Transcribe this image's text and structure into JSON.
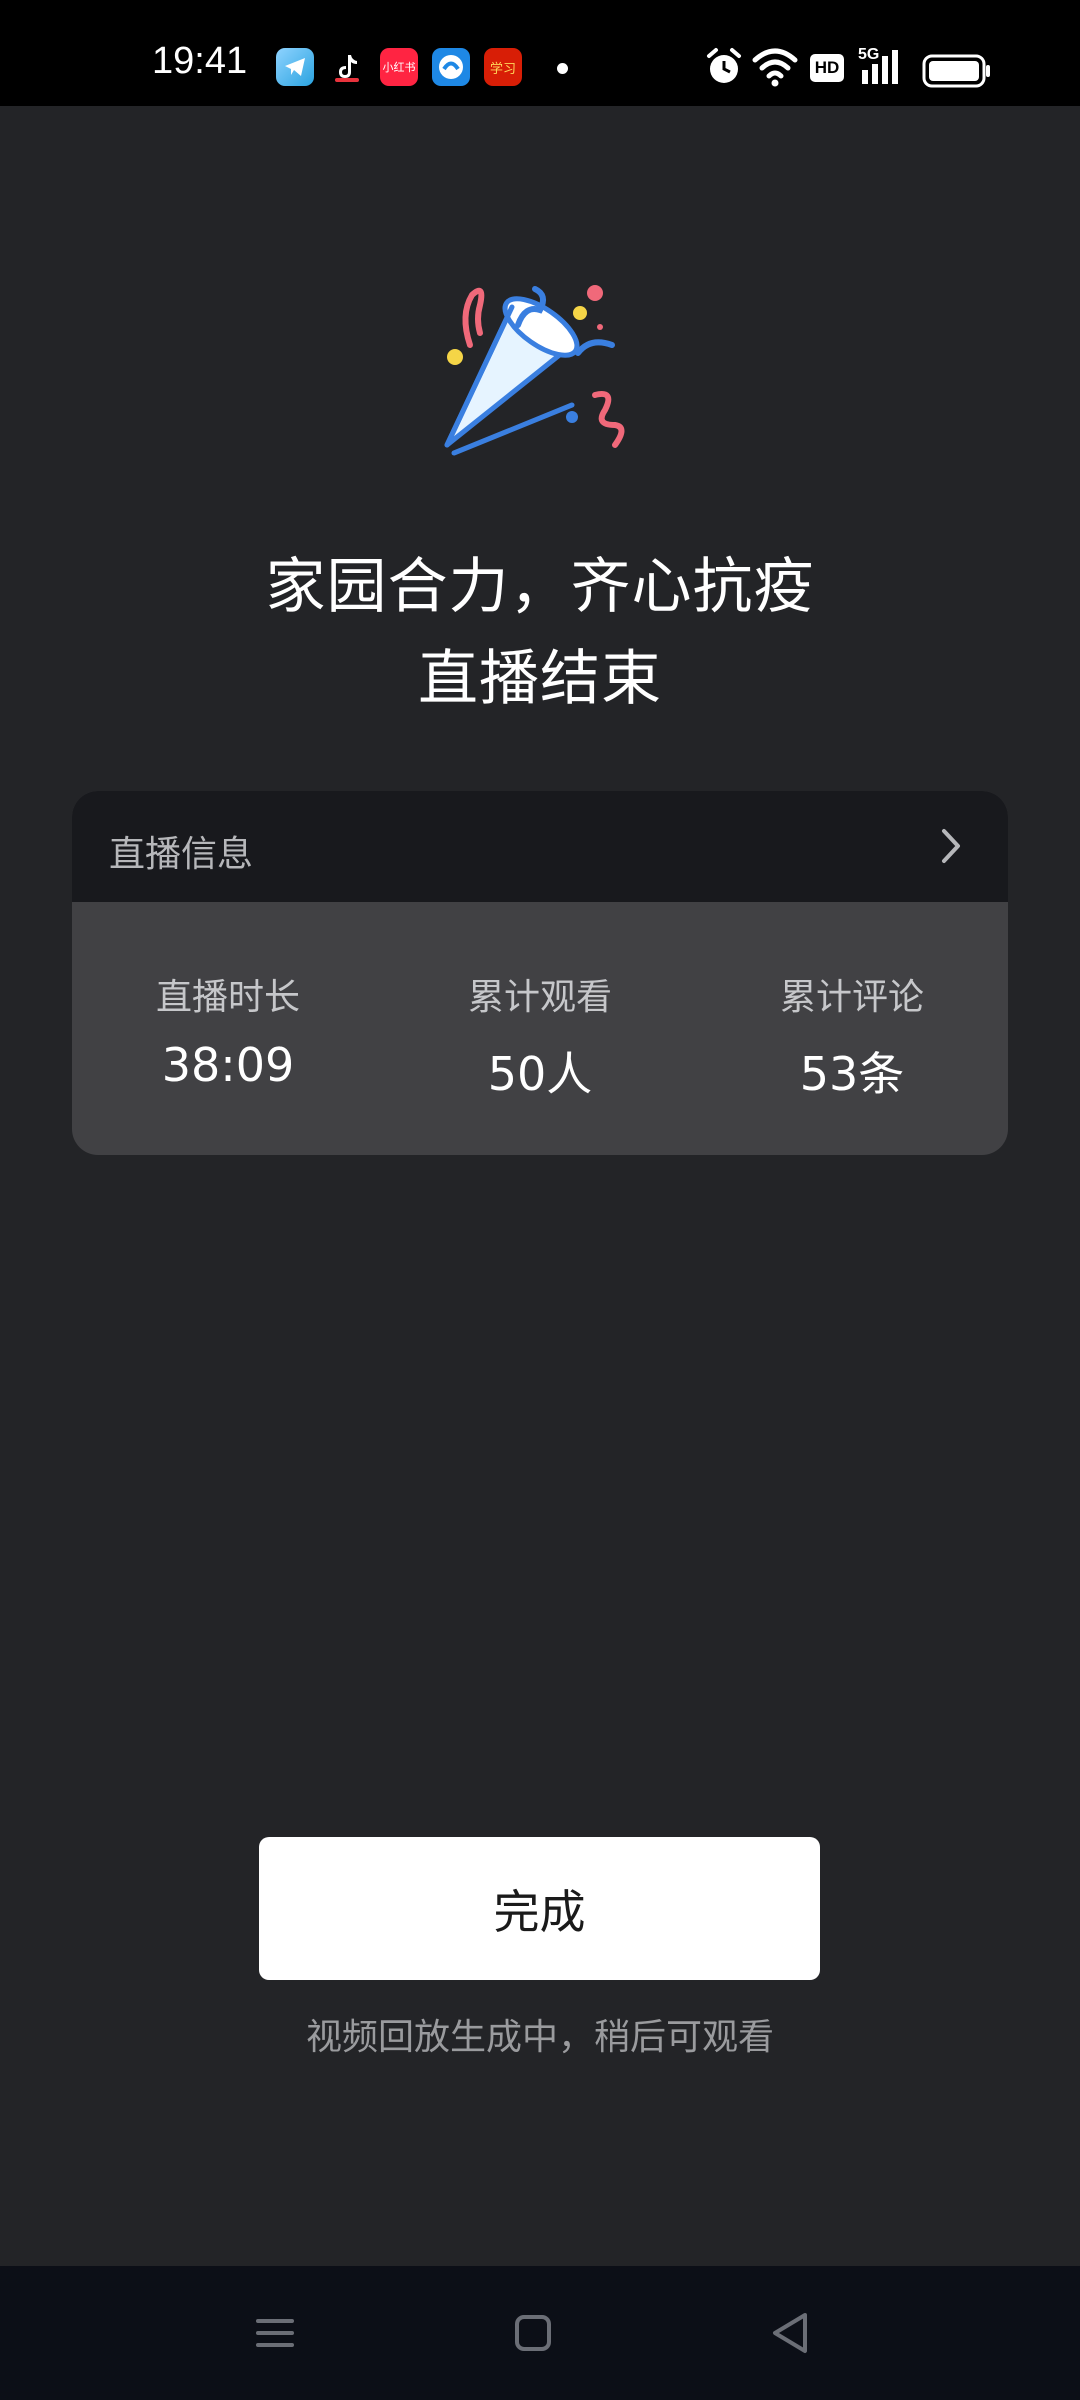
{
  "status_bar": {
    "time": "19:41",
    "apps": [
      {
        "icon": "telegram-icon",
        "label": "",
        "color": "#2aa3e0"
      },
      {
        "icon": "tiktok-icon",
        "label": "",
        "color": "#000000"
      },
      {
        "icon": "xiaohongshu-icon",
        "label": "小红书",
        "color": "#ff2442"
      },
      {
        "icon": "browser-icon",
        "label": "",
        "color": "#1e88e5"
      },
      {
        "icon": "xuexi-icon",
        "label": "学习",
        "color": "#d81e06"
      }
    ],
    "indicators": [
      "alarm-icon",
      "wifi-icon",
      "hd-icon",
      "5g-signal-icon",
      "battery-icon"
    ],
    "hd_label": "HD",
    "network_label": "5G"
  },
  "hero": {
    "icon": "party-popper-icon",
    "title_line1": "家园合力，齐心抗疫",
    "title_line2": "直播结束"
  },
  "info_card": {
    "header_label": "直播信息",
    "stats": [
      {
        "label": "直播时长",
        "value": "38:09"
      },
      {
        "label": "累计观看",
        "value": "50人"
      },
      {
        "label": "累计评论",
        "value": "53条"
      }
    ]
  },
  "actions": {
    "done_label": "完成",
    "hint": "视频回放生成中，稍后可观看"
  },
  "nav": {
    "buttons": [
      "menu-icon",
      "home-icon",
      "back-icon"
    ]
  },
  "colors": {
    "background": "#232427",
    "card_header": "#18191d",
    "card_body": "#414144",
    "confetti_red": "#f0697a",
    "confetti_blue": "#3a7fe0",
    "confetti_yellow": "#f5d547"
  }
}
